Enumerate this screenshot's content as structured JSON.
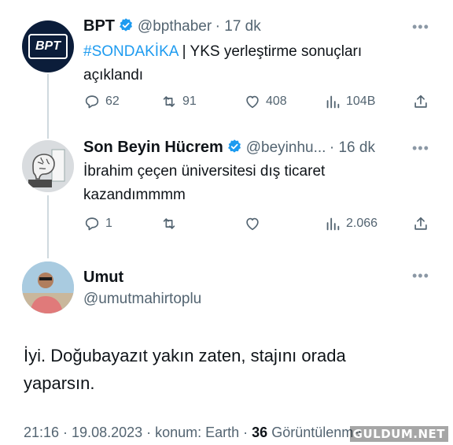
{
  "tweets": [
    {
      "name": "BPT",
      "handle": "@bpthaber",
      "time": "· 17 dk",
      "hashtag": "#SONDAKİKA",
      "text": " | YKS yerleştirme sonuçları açıklandı",
      "avatar_text": "BPT",
      "replies": "62",
      "retweets": "91",
      "likes": "408",
      "views": "104B"
    },
    {
      "name": "Son Beyin Hücrem",
      "handle": "@beyinhu...",
      "time": "· 16 dk",
      "text": "İbrahim çeçen üniversitesi dış ticaret kazandımmmm",
      "replies": "1",
      "retweets": "",
      "likes": "",
      "views": "2.066"
    }
  ],
  "main": {
    "name": "Umut",
    "handle": "@umutmahirtoplu",
    "text": "İyi. Doğubayazıt yakın zaten, stajını orada yaparsın.",
    "time": "21:16 · 19.08.2023 · konum: Earth · ",
    "views_count": "36",
    "views_label": " Görüntülenme"
  },
  "watermark": "GULDUM.NET",
  "colors": {
    "accent": "#1d9bf0",
    "muted": "#536471"
  },
  "icons": [
    "verified-icon",
    "more-icon",
    "reply-icon",
    "retweet-icon",
    "like-icon",
    "views-icon",
    "share-icon"
  ]
}
